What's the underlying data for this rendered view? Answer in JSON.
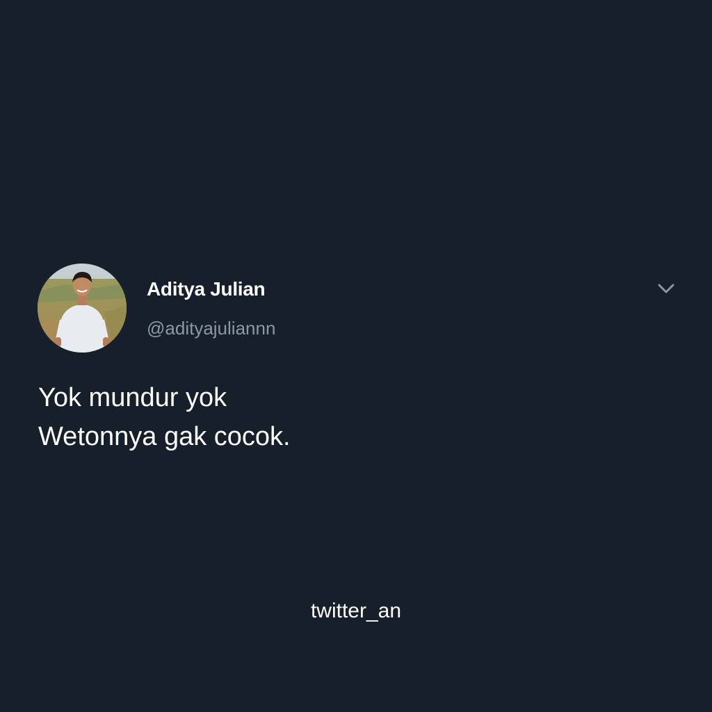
{
  "tweet": {
    "author": {
      "display_name": "Aditya Julian",
      "handle": "@adityajuliannn",
      "avatar": "profile-photo"
    },
    "menu_icon": "chevron-down-icon",
    "text_lines": [
      "Yok mundur yok",
      "Wetonnya gak cocok."
    ]
  },
  "watermark": "twitter_an",
  "colors": {
    "background": "#17202a",
    "primary_text": "#ffffff",
    "secondary_text": "#8b98a5"
  }
}
